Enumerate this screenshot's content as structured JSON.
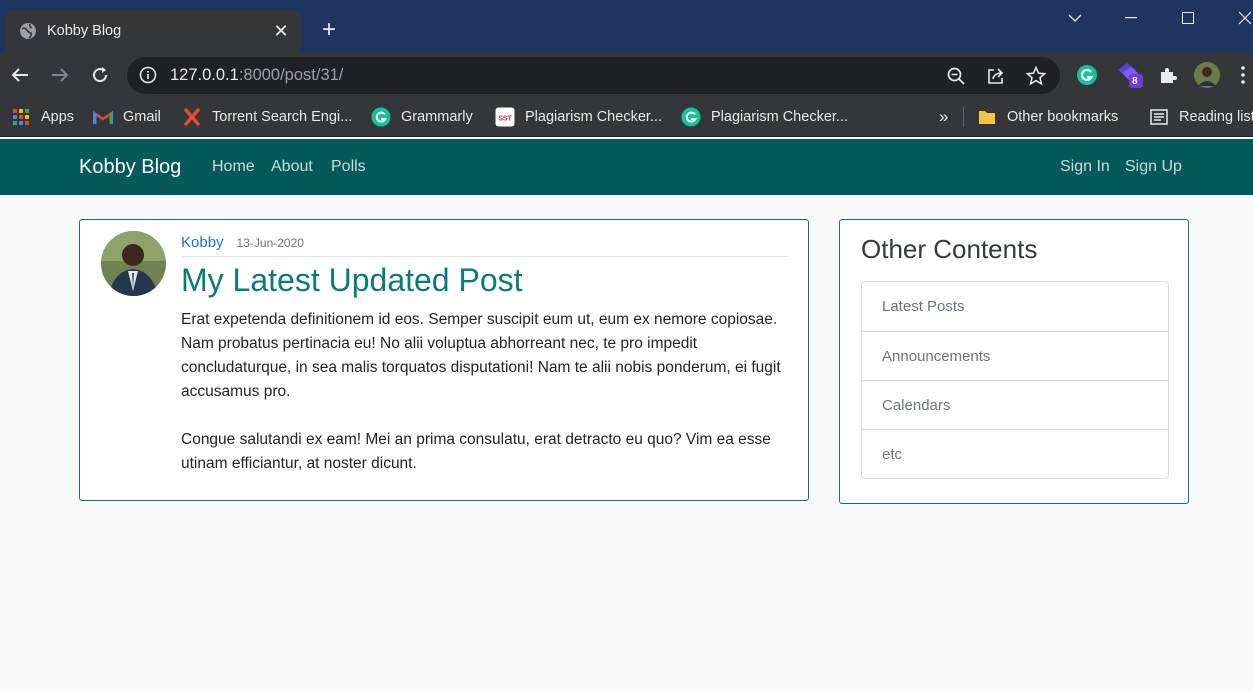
{
  "browser": {
    "tab_title": "Kobby Blog",
    "url_host": "127.0.0.1",
    "url_path": ":8000/post/31/",
    "extension_badge": "8",
    "bookmarks": [
      {
        "label": "Apps",
        "icon": "apps-grid-icon"
      },
      {
        "label": "Gmail",
        "icon": "gmail-icon"
      },
      {
        "label": "Torrent Search Engi...",
        "icon": "torrent-icon"
      },
      {
        "label": "Grammarly",
        "icon": "grammarly-icon"
      },
      {
        "label": "Plagiarism Checker...",
        "icon": "sst-icon"
      },
      {
        "label": "Plagiarism Checker...",
        "icon": "grammarly-icon"
      }
    ],
    "overflow_label": "»",
    "other_bookmarks": "Other bookmarks",
    "reading_list": "Reading list"
  },
  "site": {
    "brand": "Kobby Blog",
    "nav": {
      "home": "Home",
      "about": "About",
      "polls": "Polls"
    },
    "auth": {
      "sign_in": "Sign In",
      "sign_up": "Sign Up"
    },
    "colors": {
      "navbar": "#04595a",
      "accent": "#0b7a7c"
    }
  },
  "post": {
    "author": "Kobby",
    "date": "13-Jun-2020",
    "title": "My Latest Updated Post",
    "paragraph1": "Erat expetenda definitionem id eos. Semper suscipit eum ut, eum ex nemore copiosae. Nam probatus pertinacia eu! No alii voluptua abhorreant nec, te pro impedit concludaturque, in sea malis torquatos disputationi! Nam te alii nobis ponderum, ei fugit accusamus pro.",
    "paragraph2": "Congue salutandi ex eam! Mei an prima consulatu, erat detracto eu quo? Vim ea esse utinam efficiantur, at noster dicunt."
  },
  "sidebar": {
    "title": "Other Contents",
    "items": [
      "Latest Posts",
      "Announcements",
      "Calendars",
      "etc"
    ]
  }
}
